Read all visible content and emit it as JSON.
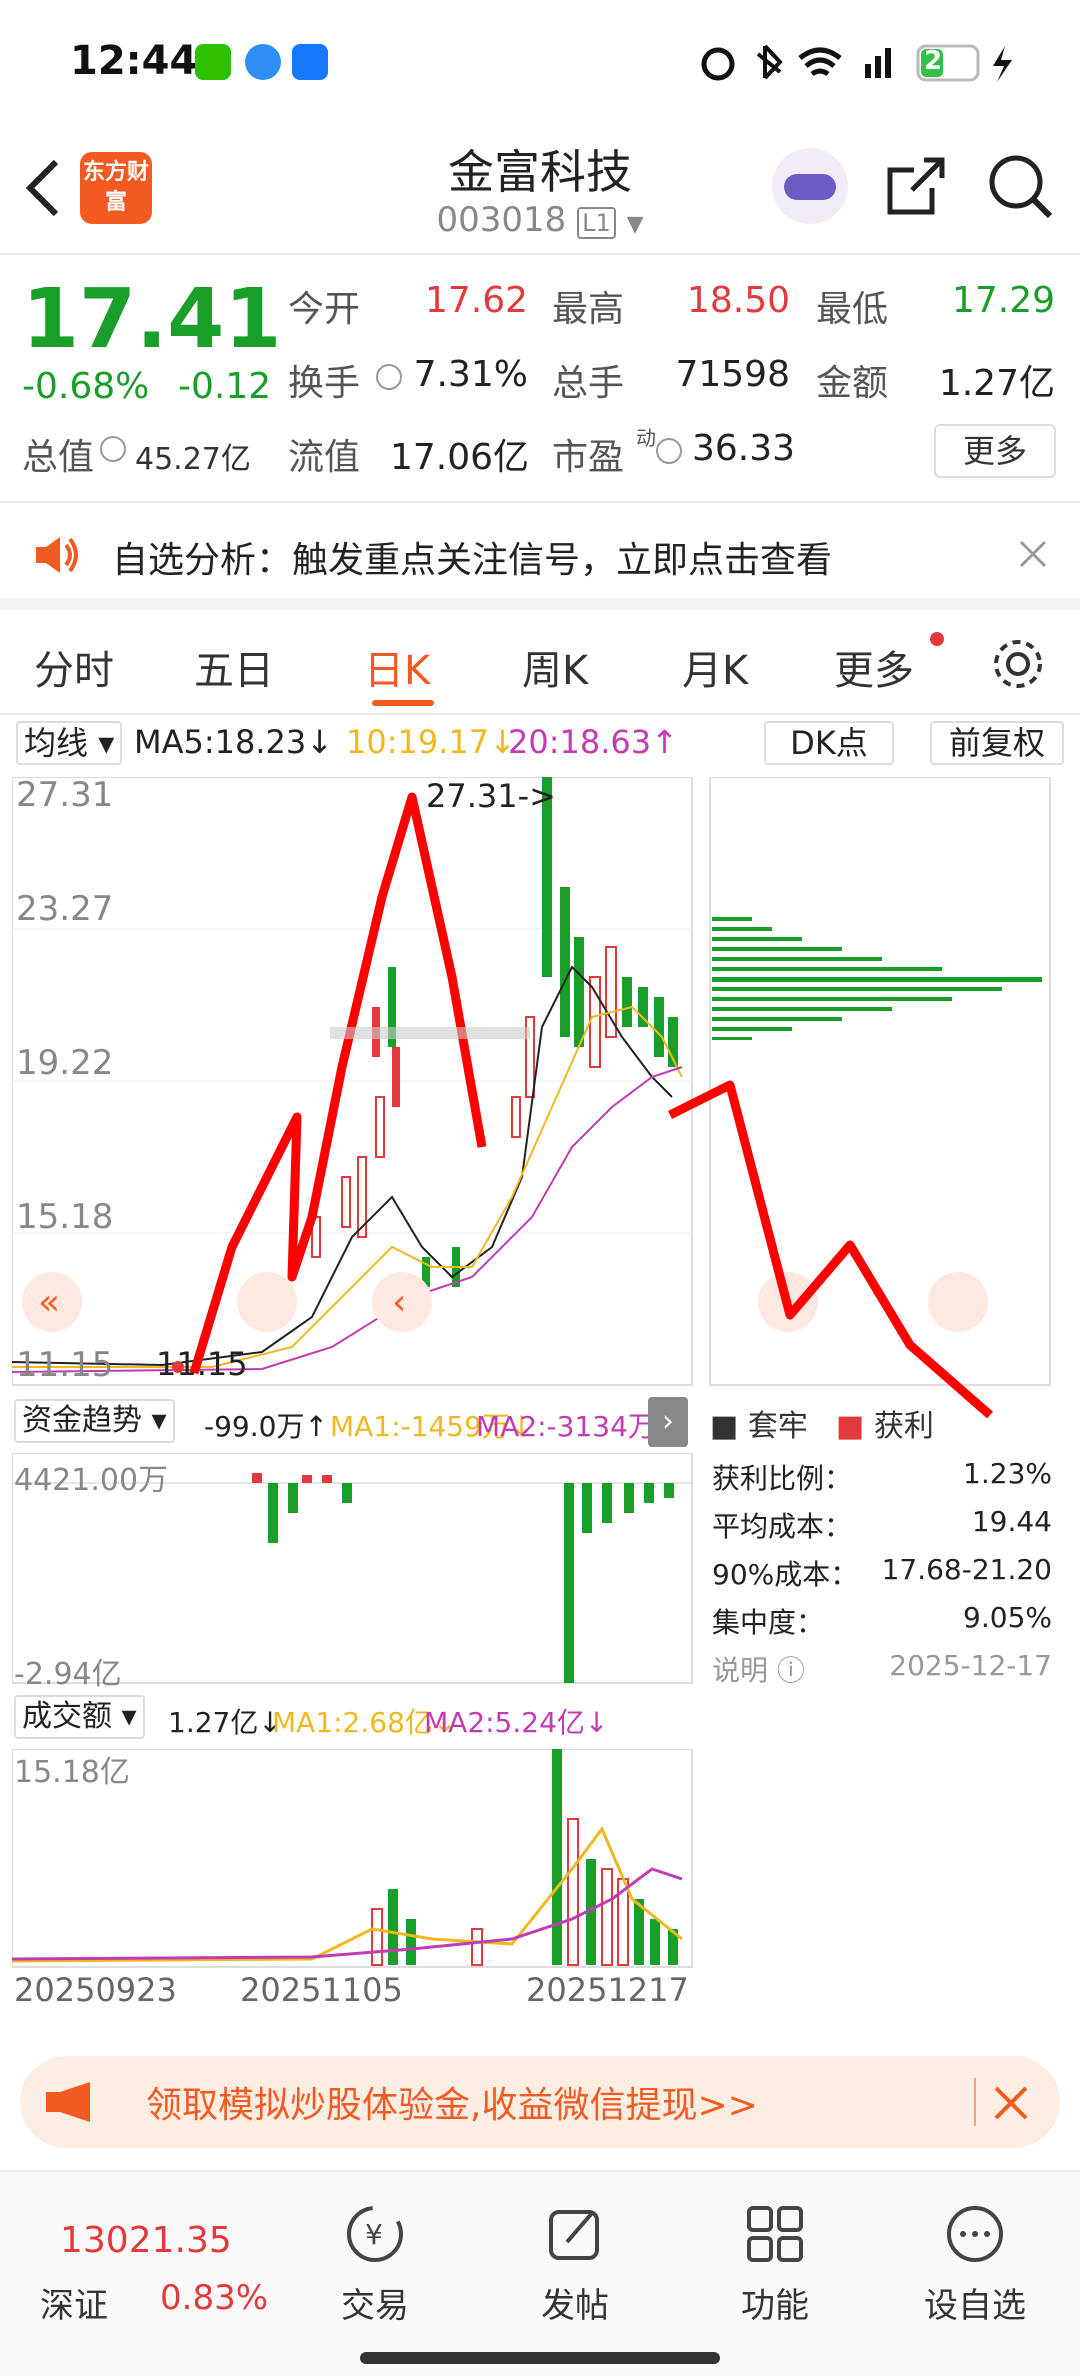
{
  "status_bar": {
    "time": "12:44",
    "battery": "25"
  },
  "header": {
    "logo_text": "东方财富",
    "title": "金富科技",
    "code": "003018",
    "level": "L1"
  },
  "quote": {
    "price": "17.41",
    "change_pct": "-0.68%",
    "change": "-0.12",
    "open_label": "今开",
    "open": "17.62",
    "high_label": "最高",
    "high": "18.50",
    "low_label": "最低",
    "low": "17.29",
    "turnover_label": "换手",
    "turnover": "7.31%",
    "volume_label": "总手",
    "volume": "71598",
    "amount_label": "金额",
    "amount": "1.27亿",
    "mktcap_label": "总值",
    "mktcap": "45.27亿",
    "float_label": "流值",
    "float": "17.06亿",
    "pe_label": "市盈",
    "pe_sup": "动",
    "pe": "36.33",
    "more_button": "更多"
  },
  "notice": {
    "text": "自选分析：触发重点关注信号，立即点击查看"
  },
  "tabs": [
    "分时",
    "五日",
    "日K",
    "周K",
    "月K",
    "更多"
  ],
  "active_tab": "日K",
  "ma_bar": {
    "selector": "均线",
    "ma5": "MA5:18.23↓",
    "ma10": "10:19.17↓",
    "ma20": "20:18.63↑",
    "dk_button": "DK点",
    "fq_button": "前复权"
  },
  "kline": {
    "y_labels": [
      "27.31",
      "23.27",
      "19.22",
      "15.18",
      "11.15"
    ],
    "high_marker": "27.31->",
    "low_marker": "11.15"
  },
  "capital": {
    "selector": "资金趋势",
    "value": "-99.0万↑",
    "ma1": "MA1:-1459万↓",
    "ma2": "MA2:-3134万↑",
    "top": "4421.00万",
    "bottom": "-2.94亿"
  },
  "turnover_chart": {
    "selector": "成交额",
    "value": "1.27亿↓",
    "ma1": "MA1:2.68亿↓",
    "ma2": "MA2:5.24亿↓",
    "top": "15.18亿",
    "dates": [
      "20250923",
      "20251105",
      "20251217"
    ]
  },
  "chips": {
    "legend_trap": "套牢",
    "legend_profit": "获利",
    "rows": [
      {
        "label": "获利比例：",
        "value": "1.23%"
      },
      {
        "label": "平均成本：",
        "value": "19.44"
      },
      {
        "label": "90%成本：",
        "value": "17.68-21.20"
      },
      {
        "label": "集中度：",
        "value": "9.05%"
      }
    ],
    "note_label": "说明",
    "date": "2025-12-17"
  },
  "banner": {
    "text": "领取模拟炒股体验金,收益微信提现>>"
  },
  "bottom_nav": {
    "index_value": "13021.35",
    "index_name": "深证",
    "index_change": "0.83%",
    "items": [
      "交易",
      "发帖",
      "功能",
      "设自选"
    ]
  },
  "colors": {
    "up": "#e4393c",
    "down": "#1a9e2a",
    "accent": "#f25a21"
  }
}
